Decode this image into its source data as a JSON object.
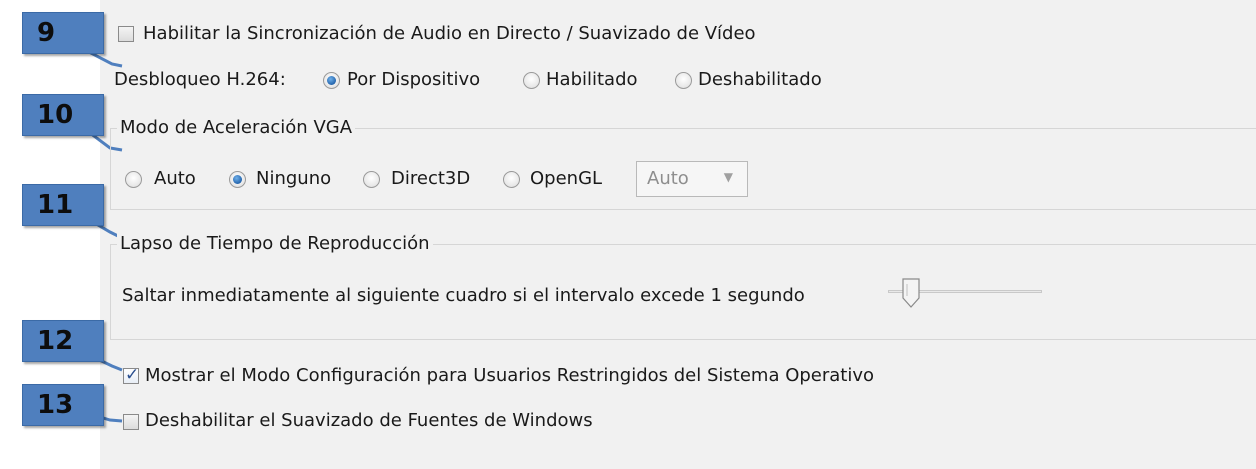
{
  "callouts": [
    "9",
    "10",
    "11",
    "12",
    "13"
  ],
  "options": {
    "live_sync": {
      "label": "Habilitar la Sincronización de Audio en Directo / Suavizado de Vídeo",
      "checked": false
    },
    "h264": {
      "label": "Desbloqueo H.264:",
      "choices": [
        "Por Dispositivo",
        "Habilitado",
        "Deshabilitado"
      ],
      "selected": "Por Dispositivo"
    },
    "vga": {
      "title": "Modo de Aceleración VGA",
      "choices": [
        "Auto",
        "Ninguno",
        "Direct3D",
        "OpenGL"
      ],
      "selected": "Ninguno",
      "dropdown_value": "Auto"
    },
    "playback": {
      "title": "Lapso de Tiempo de Reproducción",
      "skip_label": "Saltar inmediatamente al siguiente cuadro si el intervalo excede 1 segundo",
      "slider_level": 0.1
    },
    "show_config": {
      "label": "Mostrar el Modo Configuración para Usuarios Restringidos del Sistema Operativo",
      "checked": true
    },
    "disable_font_smoothing": {
      "label": "Deshabilitar el Suavizado de Fuentes de Windows",
      "checked": false
    }
  },
  "colors": {
    "callout_bg": "#4f7fbe",
    "radio_dot": "#1f5fa8",
    "panel_bg": "#f1f1f1"
  }
}
